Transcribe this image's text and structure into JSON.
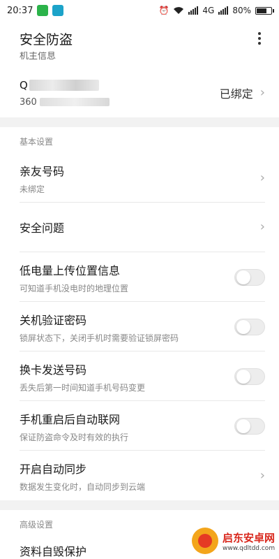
{
  "status": {
    "time": "20:37",
    "signal": "4G",
    "battery": "80%",
    "battery_level": 0.8
  },
  "header": {
    "title": "安全防盗"
  },
  "partial_text": "机主信息",
  "account": {
    "line1_prefix": "Q",
    "line2_prefix": "360",
    "status": "已绑定"
  },
  "sections": {
    "basic": "基本设置",
    "advanced": "高级设置"
  },
  "rows": {
    "friend": {
      "title": "亲友号码",
      "sub": "未绑定"
    },
    "question": {
      "title": "安全问题"
    },
    "low_battery": {
      "title": "低电量上传位置信息",
      "sub": "可知道手机没电时的地理位置"
    },
    "shutdown": {
      "title": "关机验证密码",
      "sub": "锁屏状态下，关闭手机时需要验证锁屏密码"
    },
    "sim": {
      "title": "换卡发送号码",
      "sub": "丢失后第一时间知道手机号码变更"
    },
    "reboot": {
      "title": "手机重启后自动联网",
      "sub": "保证防盗命令及时有效的执行"
    },
    "sync": {
      "title": "开启自动同步",
      "sub": "数据发生变化时，自动同步到云端"
    },
    "destroy": {
      "title": "资料自毁保护"
    }
  },
  "watermark": {
    "name": "启东安卓网",
    "url": "www.qdltdd.com"
  }
}
